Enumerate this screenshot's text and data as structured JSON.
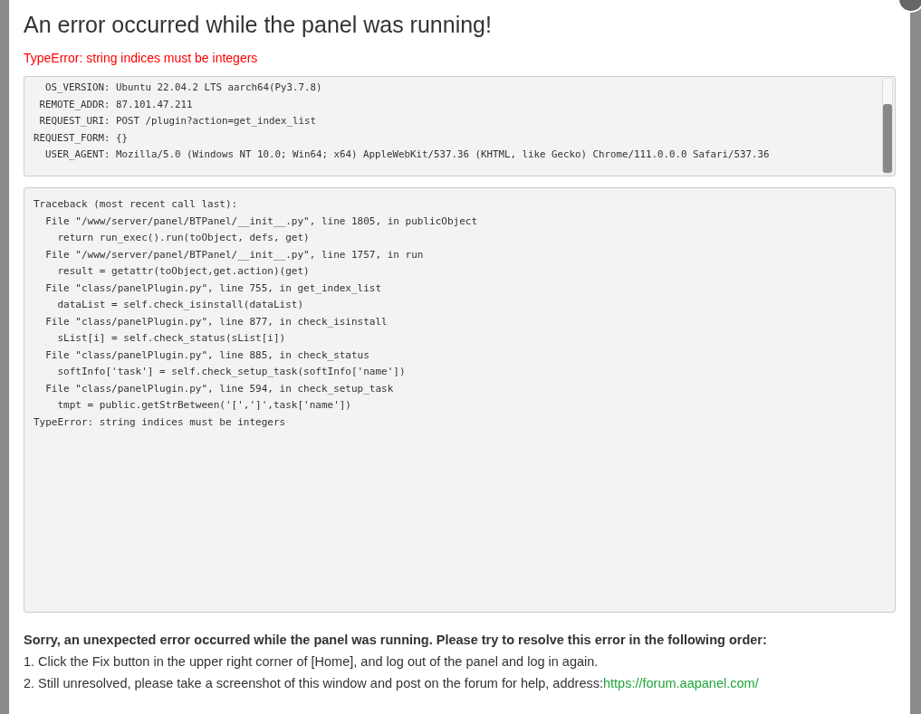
{
  "title": "An error occurred while the panel was running!",
  "error_message": "TypeError: string indices must be integers",
  "environment": [
    "  OS_VERSION: Ubuntu 22.04.2 LTS aarch64(Py3.7.8)",
    " REMOTE_ADDR: 87.101.47.211",
    " REQUEST_URI: POST /plugin?action=get_index_list",
    "REQUEST_FORM: {}",
    "  USER_AGENT: Mozilla/5.0 (Windows NT 10.0; Win64; x64) AppleWebKit/537.36 (KHTML, like Gecko) Chrome/111.0.0.0 Safari/537.36"
  ],
  "traceback": [
    "Traceback (most recent call last):",
    "  File \"/www/server/panel/BTPanel/__init__.py\", line 1805, in publicObject",
    "    return run_exec().run(toObject, defs, get)",
    "  File \"/www/server/panel/BTPanel/__init__.py\", line 1757, in run",
    "    result = getattr(toObject,get.action)(get)",
    "  File \"class/panelPlugin.py\", line 755, in get_index_list",
    "    dataList = self.check_isinstall(dataList)",
    "  File \"class/panelPlugin.py\", line 877, in check_isinstall",
    "    sList[i] = self.check_status(sList[i])",
    "  File \"class/panelPlugin.py\", line 885, in check_status",
    "    softInfo['task'] = self.check_setup_task(softInfo['name'])",
    "  File \"class/panelPlugin.py\", line 594, in check_setup_task",
    "    tmpt = public.getStrBetween('[',']',task['name'])",
    "TypeError: string indices must be integers"
  ],
  "help": {
    "heading": "Sorry, an unexpected error occurred while the panel was running. Please try to resolve this error in the following order:",
    "steps": [
      "1. Click the Fix button in the upper right corner of [Home], and log out of the panel and log in again.",
      "2. Still unresolved, please take a screenshot of this window and post on the forum for help, address:"
    ],
    "link": "https://forum.aapanel.com/"
  }
}
